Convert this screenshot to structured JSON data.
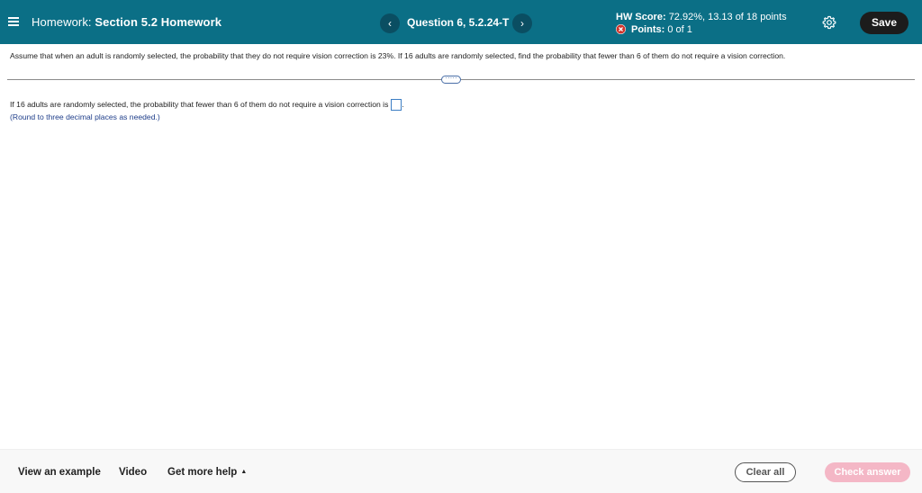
{
  "header": {
    "hw_prefix": "Homework:",
    "hw_name": "Section 5.2 Homework",
    "prev_icon": "‹",
    "next_icon": "›",
    "question_label": "Question 6, 5.2.24-T",
    "score_label": "HW Score:",
    "score_value": "72.92%, 13.13 of 18 points",
    "points_label": "Points:",
    "points_value": "0 of 1",
    "save_label": "Save",
    "colors": {
      "header_bg": "#0b6f86",
      "nav_btn_bg": "#0a4e62",
      "incorrect": "#d0342c"
    }
  },
  "question": {
    "text": "Assume that when an adult is randomly selected, the probability that they do not require vision correction is 23%. If 16 adults are randomly selected, find the probability that fewer than 6 of them do not require a vision correction.",
    "expander_label": "·····",
    "answer_prefix": "If 16 adults are randomly selected, the probability that fewer than 6 of them do not require a vision correction is",
    "answer_suffix": ".",
    "answer_value": "",
    "round_note": "(Round to three decimal places as needed.)"
  },
  "footer": {
    "view_example": "View an example",
    "video": "Video",
    "get_more_help": "Get more help",
    "get_more_help_caret": "▲",
    "clear_all": "Clear all",
    "check_answer": "Check answer",
    "colors": {
      "check_answer_bg": "#f4b7c6"
    }
  },
  "icons": {
    "menu": "hamburger-menu-icon",
    "prev": "chevron-left-icon",
    "next": "chevron-right-icon",
    "points_status": "incorrect-x-circle-icon",
    "settings": "gear-icon"
  }
}
